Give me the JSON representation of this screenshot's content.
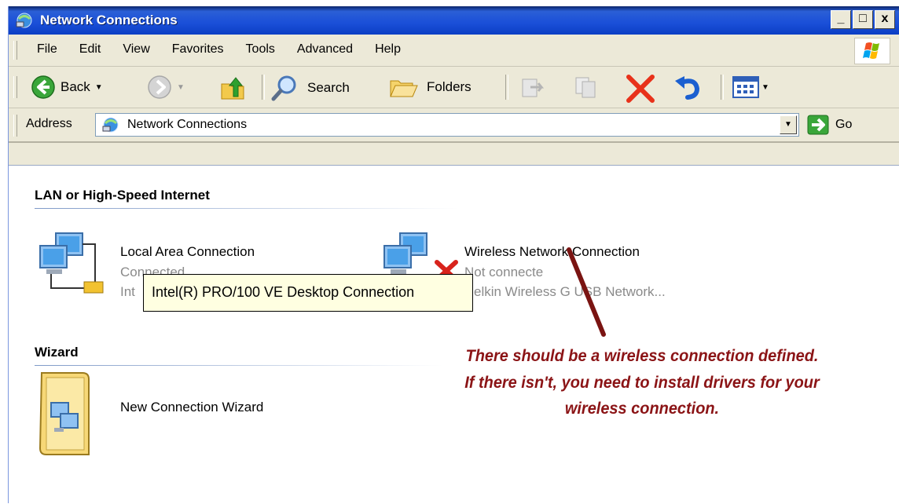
{
  "window": {
    "title": "Network Connections",
    "controls": {
      "minimize": "_",
      "maximize": "□",
      "close": "x"
    }
  },
  "menu": {
    "items": [
      "File",
      "Edit",
      "View",
      "Favorites",
      "Tools",
      "Advanced",
      "Help"
    ]
  },
  "toolbar": {
    "back_label": "Back",
    "search_label": "Search",
    "folders_label": "Folders"
  },
  "address": {
    "label": "Address",
    "value": "Network Connections",
    "go_label": "Go"
  },
  "groups": {
    "lan": {
      "header": "LAN or High-Speed Internet",
      "items": [
        {
          "name": "Local Area Connection",
          "status": "Connected",
          "device": "Int"
        },
        {
          "name": "Wireless Network Connection",
          "status": "Not connecte",
          "device": "elkin Wireless G USB Network..."
        }
      ]
    },
    "wizard": {
      "header": "Wizard",
      "items": [
        {
          "name": "New Connection Wizard"
        }
      ]
    }
  },
  "tooltip": "Intel(R) PRO/100 VE Desktop Connection",
  "annotation": {
    "lines": [
      "There should be a wireless connection defined.",
      "If there isn't, you need to install drivers for your",
      "wireless connection."
    ],
    "color": "#8b1416"
  },
  "colors": {
    "titlebar": "#0b3ec4",
    "chrome": "#ECE9D8",
    "status_gray": "#8a8a8a"
  }
}
